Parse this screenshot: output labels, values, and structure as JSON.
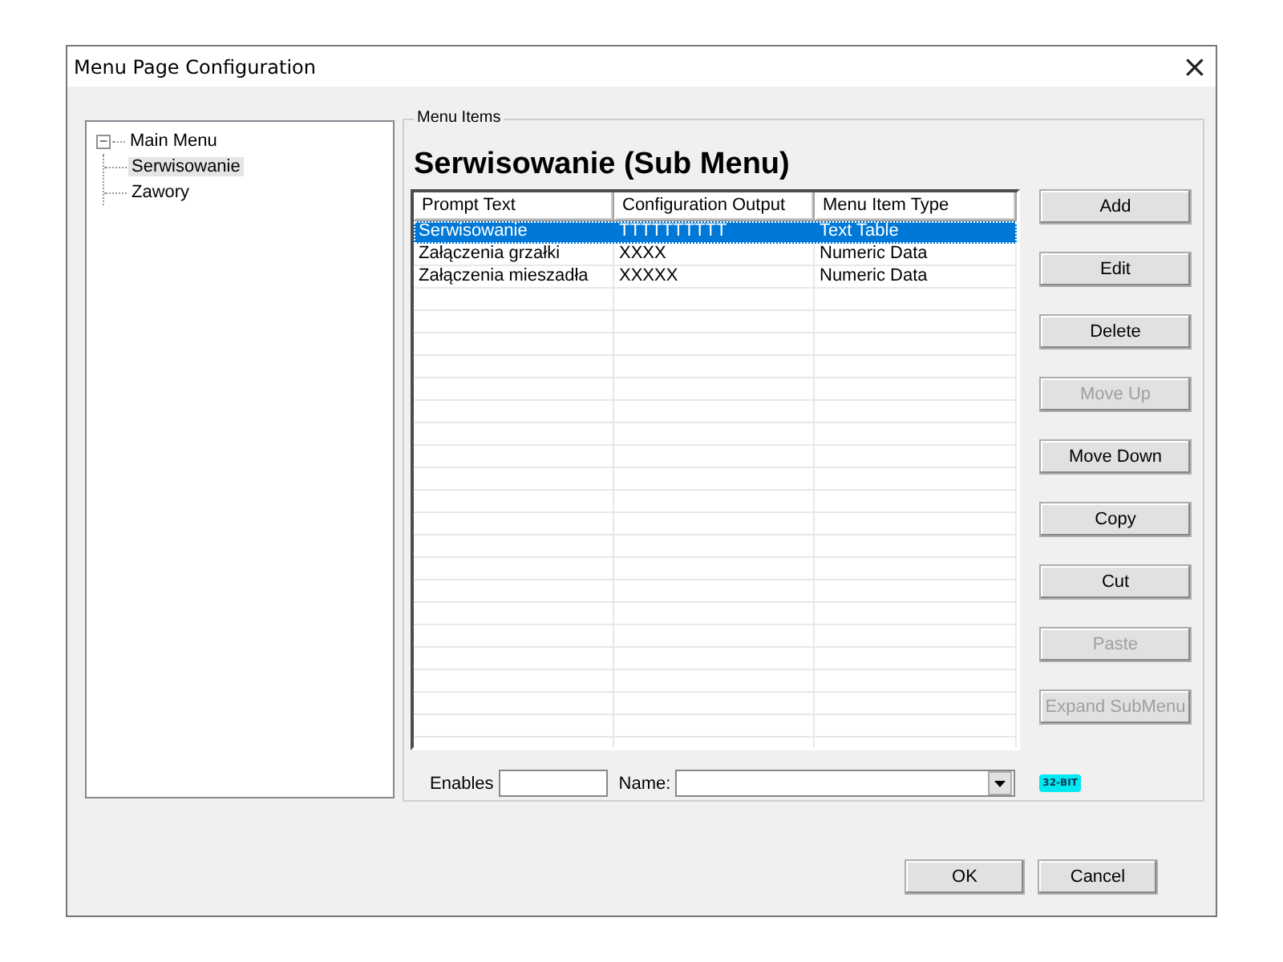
{
  "window": {
    "title": "Menu Page Configuration",
    "close": "×"
  },
  "tree": [
    {
      "label": "Main Menu",
      "expanded": true,
      "selected": false,
      "toggle": "−",
      "children": [
        {
          "label": "Serwisowanie",
          "selected": true
        },
        {
          "label": "Zawory",
          "selected": false
        }
      ]
    }
  ],
  "menu_items": {
    "group_label": "Menu Items",
    "heading": "Serwisowanie (Sub Menu)",
    "table": {
      "columns": [
        "Prompt Text",
        "Configuration Output",
        "Menu Item Type"
      ],
      "rows": [
        {
          "cells": [
            "Serwisowanie",
            "TTTTTTTTTT",
            "Text Table"
          ],
          "selected": true
        },
        {
          "cells": [
            "Załączenia grzałki",
            "XXXX",
            "Numeric Data"
          ],
          "selected": false
        },
        {
          "cells": [
            "Załączenia mieszadła",
            "XXXXX",
            "Numeric Data"
          ],
          "selected": false
        }
      ]
    },
    "buttons": [
      {
        "label": "Add",
        "disabled": false
      },
      {
        "label": "Edit",
        "disabled": false
      },
      {
        "label": "Delete",
        "disabled": false
      },
      {
        "label": "Move Up",
        "disabled": true
      },
      {
        "label": "Move Down",
        "disabled": false
      },
      {
        "label": "Copy",
        "disabled": false
      },
      {
        "label": "Cut",
        "disabled": false
      },
      {
        "label": "Paste",
        "disabled": true
      },
      {
        "label": "Expand SubMenu",
        "disabled": true
      }
    ],
    "enables_label": "Enables",
    "name_label": "Name:",
    "badge": "32-BIT"
  },
  "footer_buttons": [
    "OK",
    "Cancel"
  ]
}
